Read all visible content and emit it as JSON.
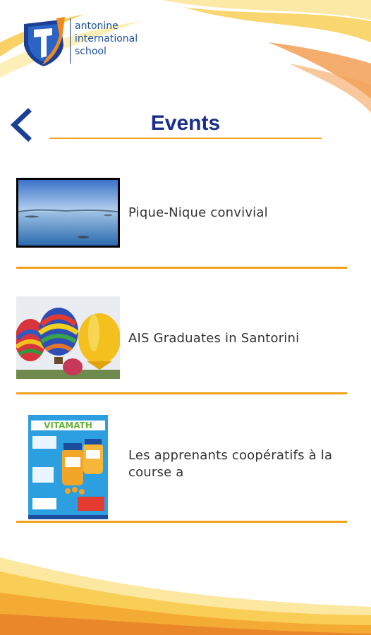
{
  "app": {
    "logo_lines": [
      "antonine",
      "international",
      "school"
    ]
  },
  "header": {
    "title": "Events",
    "back_icon": "chevron-left-icon"
  },
  "colors": {
    "accent_orange": "#f1a11c",
    "title_blue": "#1a2e8a",
    "logo_blue": "#1a4fa5"
  },
  "events": [
    {
      "title": "Pique-Nique convivial",
      "thumbnail": "lake-photo"
    },
    {
      "title": "AIS Graduates in Santorini",
      "thumbnail": "hot-air-balloons-photo"
    },
    {
      "title": "Les apprenants coopératifs à la course a",
      "thumbnail": "vitamath-poster",
      "poster_title": "VITAMATH"
    }
  ]
}
